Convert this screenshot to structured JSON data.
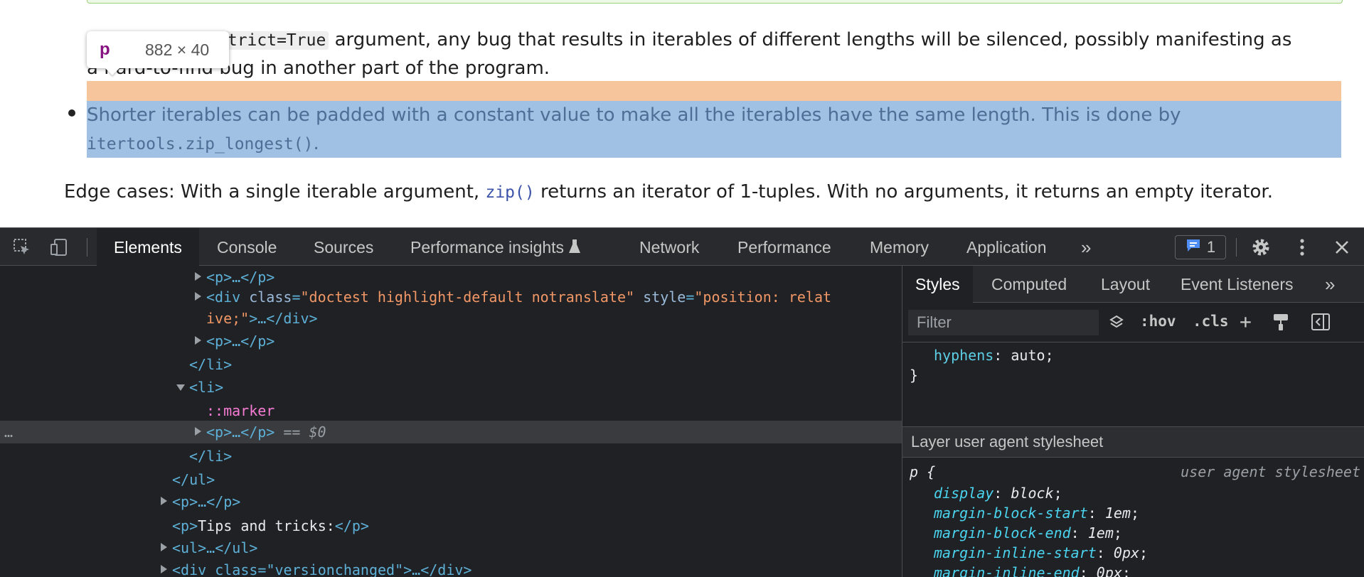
{
  "page": {
    "para1_code": "strict=True",
    "para1_line1_rest": " argument, any bug that results in iterables of different lengths will be silenced, possibly manifesting as",
    "para1_line2": "a hard-to-find bug in another part of the program.",
    "tooltip_tag": "p",
    "tooltip_dims": "882 × 40",
    "para2_line1": "Shorter iterables can be padded with a constant value to make all the iterables have the same length. This is done by",
    "para2_code": "itertools.zip_longest()",
    "para2_end": ".",
    "para3_before": "Edge cases: With a single iterable argument, ",
    "para3_code": "zip()",
    "para3_after": " returns an iterator of 1-tuples. With no arguments, it returns an empty iterator."
  },
  "devtools": {
    "tabs": [
      "Elements",
      "Console",
      "Sources",
      "Performance insights",
      "Network",
      "Performance",
      "Memory",
      "Application"
    ],
    "issues_count": "1",
    "tree": {
      "r1": "<p>…</p>",
      "r2_open": "<div ",
      "r2_attr1_name": "class",
      "r2_attr1_val": "\"doctest highlight-default notranslate\"",
      "r2_attr2_name": " style",
      "r2_attr2_val_a": "\"position: relat",
      "r2_attr2_val_b": "ive;\"",
      "r2_close": ">…</div>",
      "r3": "<p>…</p>",
      "r4": "</li>",
      "r5": "<li>",
      "r6": "::marker",
      "r7": "<p>…</p>",
      "r7_suffix": " == $0",
      "r8": "</li>",
      "r9": "</ul>",
      "r10": "<p>…</p>",
      "r11_open": "<p>",
      "r11_text": "Tips and tricks:",
      "r11_close": "</p>",
      "r12": "<ul>…</ul>",
      "r13": "<div class=\"versionchanged\">…</div>",
      "selected_dots": "…"
    },
    "side_tabs": [
      "Styles",
      "Computed",
      "Layout",
      "Event Listeners"
    ],
    "filter_placeholder": "Filter",
    "filter_tools": {
      "hov": ":hov",
      "cls": ".cls",
      "add": "+"
    },
    "styles": {
      "hyphens_prop": "hyphens",
      "hyphens_val": "auto",
      "layer_header": "Layer user agent stylesheet",
      "selector": "p {",
      "source": "user agent stylesheet",
      "props": [
        {
          "name": "display",
          "value": "block"
        },
        {
          "name": "margin-block-start",
          "value": "1em"
        },
        {
          "name": "margin-block-end",
          "value": "1em"
        },
        {
          "name": "margin-inline-start",
          "value": "0px"
        },
        {
          "name": "margin-inline-end",
          "value": "0px"
        }
      ],
      "close_brace": "}"
    }
  }
}
